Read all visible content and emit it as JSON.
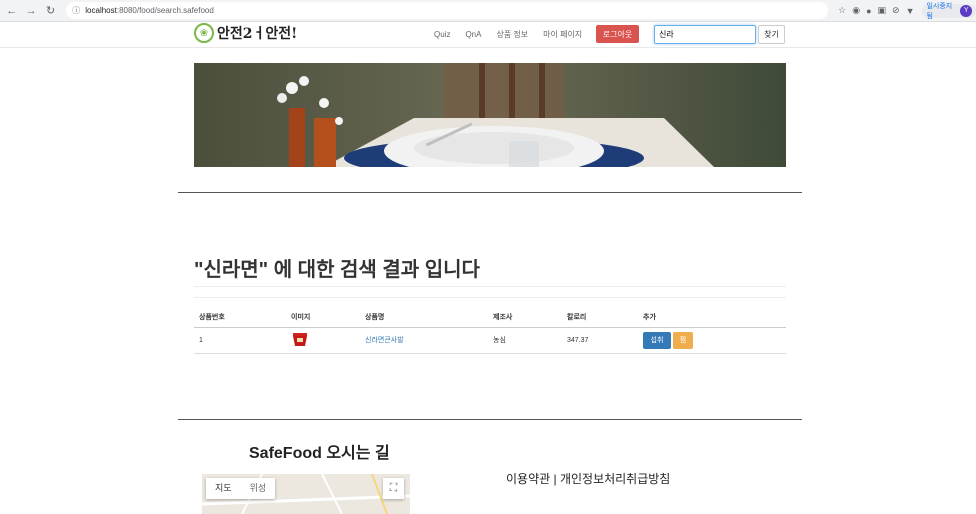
{
  "browser": {
    "url_host": "localhost",
    "url_path": ":8080/food/search.safefood",
    "profile_label": "일시중지됨",
    "avatar_letter": "Y"
  },
  "header": {
    "logo_text": "안전2ㅓ안전!",
    "menu": [
      "Quiz",
      "QnA",
      "상품 정보",
      "마이 페이지"
    ],
    "logout_label": "로그아웃",
    "search_value": "신라",
    "search_button": "찾기"
  },
  "results": {
    "title": "\"신라면\" 에 대한 검색 결과 입니다",
    "columns": [
      "상품번호",
      "이미지",
      "상품명",
      "제조사",
      "칼로리",
      "추가"
    ],
    "rows": [
      {
        "id": "1",
        "name": "신라면큰사발",
        "maker": "농심",
        "calories": "347.37",
        "intake_label": "섭취",
        "like_label": "찜"
      }
    ]
  },
  "footer": {
    "directions_title": "SafeFood 오시는 길",
    "map_tabs": [
      "지도",
      "위성"
    ],
    "terms": "이용약관 | 개인정보처리취급방침"
  },
  "colors": {
    "logout": "#d9534f",
    "intake": "#337ab7",
    "like": "#f0ad4e",
    "link": "#337ab7"
  }
}
